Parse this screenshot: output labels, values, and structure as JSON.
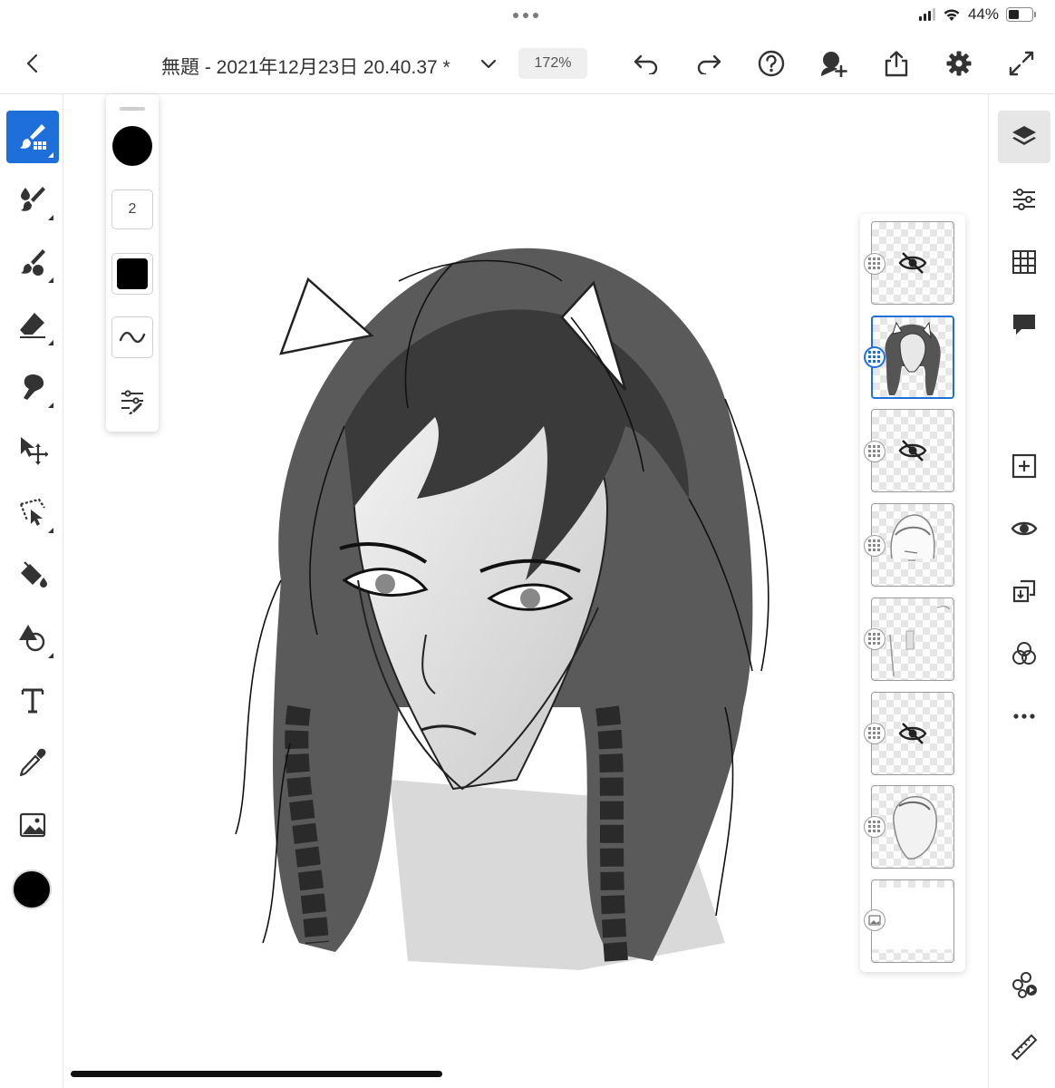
{
  "status_bar": {
    "battery": "44%",
    "battery_level": 0.44
  },
  "header": {
    "title": "無題 - 2021年12月23日 20.40.37 *",
    "zoom": "172%",
    "icons": [
      "back-icon",
      "chevron-down-icon",
      "undo-icon",
      "redo-icon",
      "help-icon",
      "invite-icon",
      "share-icon",
      "settings-icon",
      "fullscreen-icon"
    ]
  },
  "left_toolbar": {
    "tools": [
      "pixel-brush",
      "live-brush",
      "vector-brush",
      "eraser",
      "smudge",
      "transform",
      "selection",
      "fill",
      "shapes",
      "type",
      "eyedropper",
      "image"
    ],
    "active_tool": "pixel-brush",
    "current_color": "#000000"
  },
  "brush_panel": {
    "color": "#000000",
    "size": "2",
    "opacity_color": "#000000"
  },
  "layers": {
    "items": [
      {
        "type": "pixel",
        "hidden": true,
        "selected": false
      },
      {
        "type": "pixel",
        "hidden": false,
        "selected": true
      },
      {
        "type": "pixel",
        "hidden": true,
        "selected": false
      },
      {
        "type": "pixel",
        "hidden": false,
        "selected": false
      },
      {
        "type": "pixel",
        "hidden": false,
        "selected": false
      },
      {
        "type": "pixel",
        "hidden": true,
        "selected": false
      },
      {
        "type": "pixel",
        "hidden": false,
        "selected": false
      },
      {
        "type": "image",
        "hidden": false,
        "selected": false
      }
    ]
  },
  "right_toolbar": {
    "icons": [
      "layers-icon",
      "layer-properties-icon",
      "grid-icon",
      "comments-icon",
      "add-layer-icon",
      "visibility-icon",
      "merge-down-icon",
      "blend-mode-icon",
      "more-icon",
      "livestream-icon",
      "ruler-icon"
    ]
  },
  "colors": {
    "accent": "#1e6fd9"
  }
}
